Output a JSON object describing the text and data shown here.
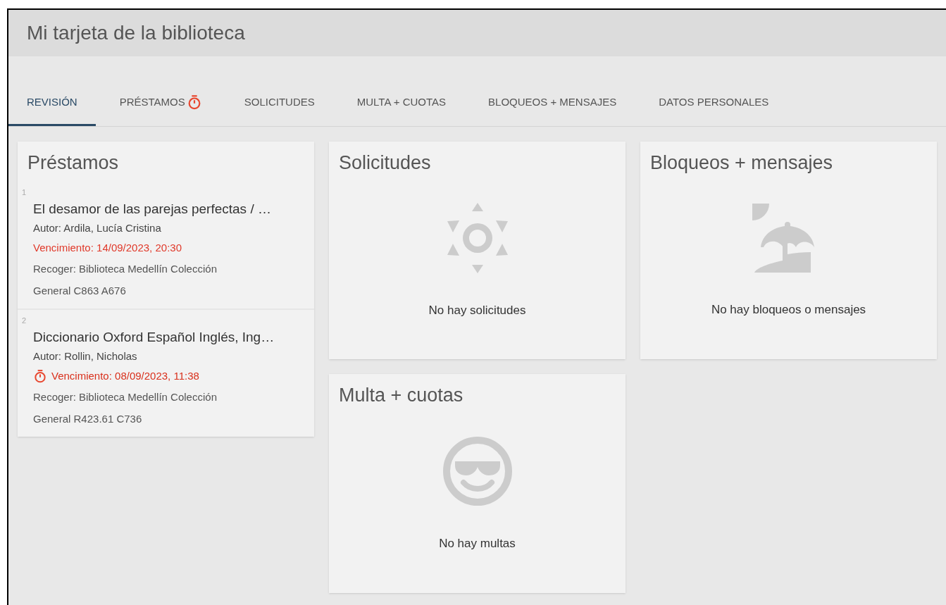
{
  "header": {
    "title": "Mi tarjeta de la biblioteca"
  },
  "tabs": [
    {
      "label": "REVISIÓN",
      "selected": true,
      "alert": false
    },
    {
      "label": "PRÉSTAMOS",
      "selected": false,
      "alert": true
    },
    {
      "label": "SOLICITUDES",
      "selected": false,
      "alert": false
    },
    {
      "label": "MULTA + CUOTAS",
      "selected": false,
      "alert": false
    },
    {
      "label": "BLOQUEOS + MENSAJES",
      "selected": false,
      "alert": false
    },
    {
      "label": "DATOS PERSONALES",
      "selected": false,
      "alert": false
    }
  ],
  "loans": {
    "title": "Préstamos",
    "items": [
      {
        "number": "1",
        "title": "El desamor de las parejas perfectas / …",
        "author": "Autor: Ardila, Lucía Cristina",
        "due": "Vencimiento: 14/09/2023, 20:30",
        "overdue": false,
        "pickup": [
          "Recoger: Biblioteca Medellín Colección",
          "General C863 A676"
        ]
      },
      {
        "number": "2",
        "title": "Diccionario Oxford Español Inglés, Ing…",
        "author": "Autor: Rollin, Nicholas",
        "due": "Vencimiento: 08/09/2023, 11:38",
        "overdue": true,
        "pickup": [
          "Recoger: Biblioteca Medellín Colección",
          "General R423.61 C736"
        ]
      }
    ]
  },
  "requests": {
    "title": "Solicitudes",
    "kind": "sun",
    "message": "No hay solicitudes"
  },
  "blocks": {
    "title": "Bloqueos + mensajes",
    "kind": "beach",
    "message": "No hay bloqueos o mensajes"
  },
  "fines": {
    "title": "Multa + cuotas",
    "kind": "smile",
    "message": "No hay multas"
  }
}
